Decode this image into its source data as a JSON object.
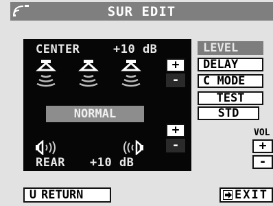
{
  "header": {
    "title": "SUR EDIT",
    "signal_icon": "signal-icon"
  },
  "panel": {
    "center": {
      "label": "CENTER",
      "value": "+10 dB"
    },
    "mode": "NORMAL",
    "rear": {
      "label": "REAR",
      "value": "+10 dB"
    },
    "plus_label": "+",
    "minus_label": "-"
  },
  "menu": {
    "level": "LEVEL",
    "delay": "DELAY",
    "c_mode": "C MODE",
    "test": "TEST",
    "std": "STD"
  },
  "volume": {
    "label": "VOL",
    "plus": "+",
    "minus": "-"
  },
  "bottom": {
    "return_label": "RETURN",
    "return_icon": "U",
    "exit_label": "EXIT"
  }
}
